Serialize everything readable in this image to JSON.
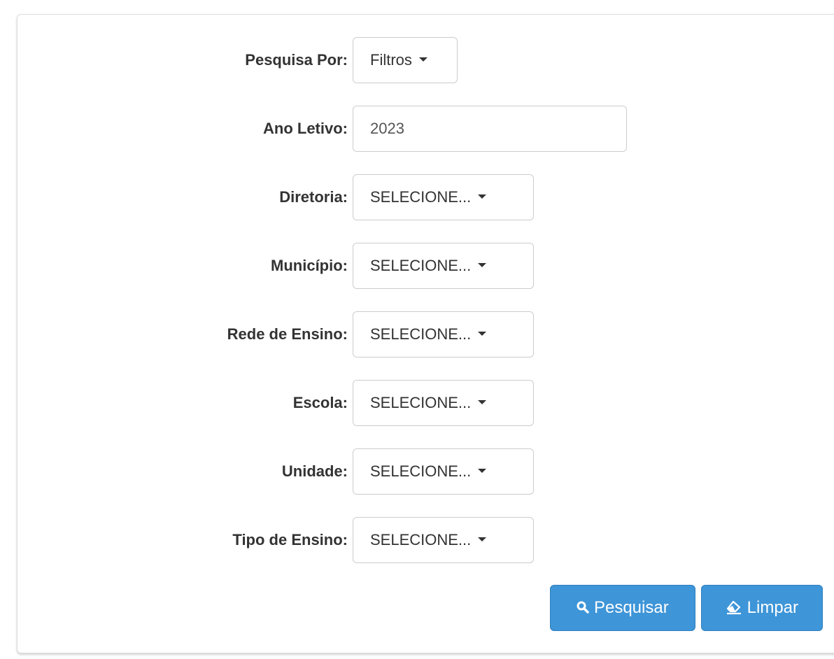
{
  "form": {
    "fields": [
      {
        "label": "Pesquisa Por:",
        "value": "Filtros",
        "kind": "dropdown"
      },
      {
        "label": "Ano Letivo:",
        "value": "2023",
        "kind": "input"
      },
      {
        "label": "Diretoria:",
        "value": "SELECIONE...",
        "kind": "dropdown"
      },
      {
        "label": "Município:",
        "value": "SELECIONE...",
        "kind": "dropdown"
      },
      {
        "label": "Rede de Ensino:",
        "value": "SELECIONE...",
        "kind": "dropdown"
      },
      {
        "label": "Escola:",
        "value": "SELECIONE...",
        "kind": "dropdown"
      },
      {
        "label": "Unidade:",
        "value": "SELECIONE...",
        "kind": "dropdown"
      },
      {
        "label": "Tipo de Ensino:",
        "value": "SELECIONE...",
        "kind": "dropdown"
      }
    ]
  },
  "actions": {
    "search_label": "Pesquisar",
    "search_icon": "search-icon",
    "clear_label": "Limpar",
    "clear_icon": "eraser-icon"
  },
  "colors": {
    "primary": "#3e95d8",
    "label_text": "#333333",
    "border": "#cccccc"
  }
}
